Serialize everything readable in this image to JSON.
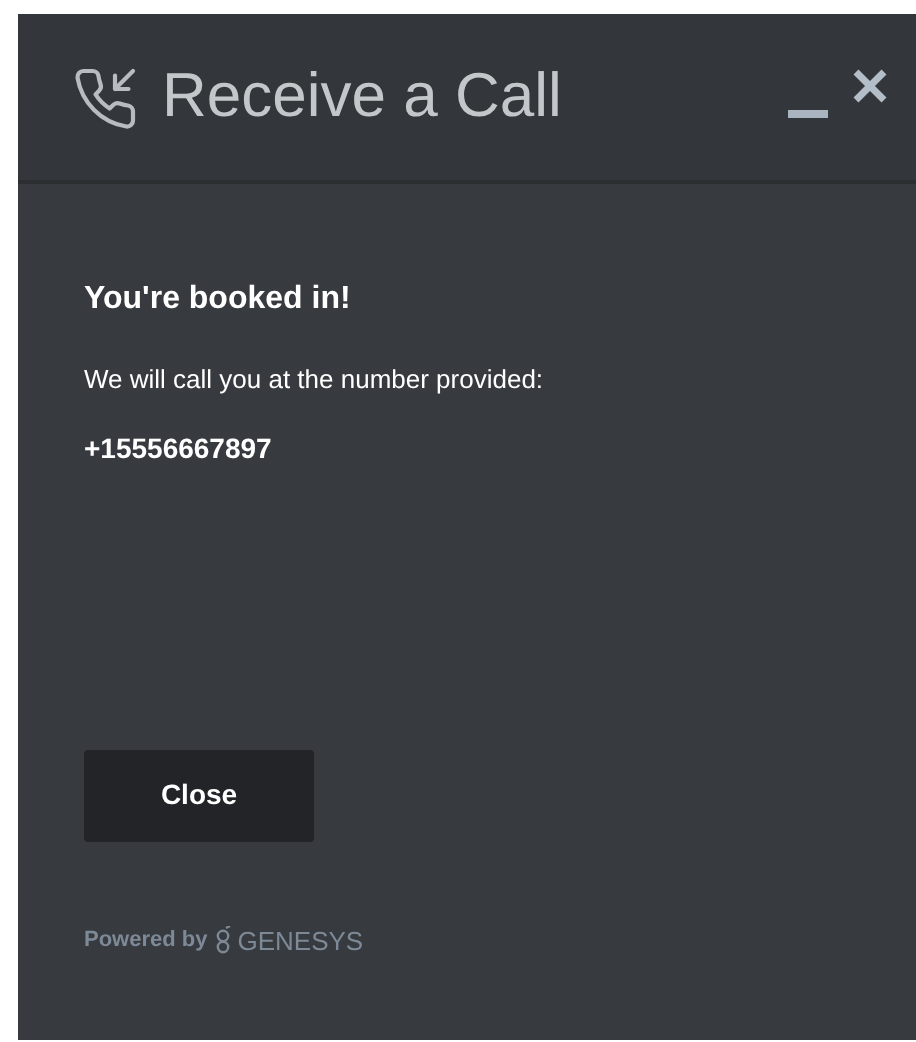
{
  "window": {
    "title": "Receive a Call"
  },
  "heading": "You're booked in!",
  "message": "We will call you at the number provided:",
  "phone": "+15556667897",
  "buttons": [
    "Close"
  ],
  "footer": {
    "powered_by": "Powered by",
    "brand": "GENESYS"
  }
}
